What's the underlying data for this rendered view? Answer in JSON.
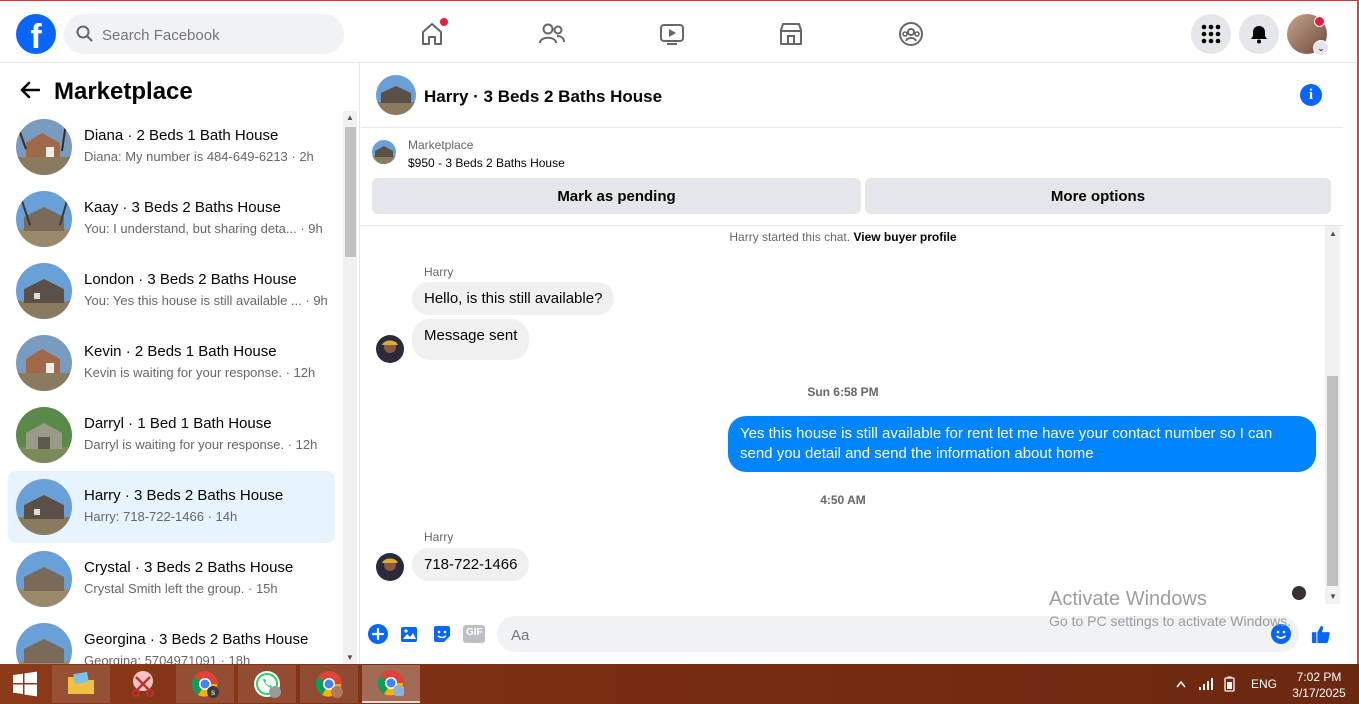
{
  "topbar": {
    "logo": "f",
    "search_placeholder": "Search Facebook"
  },
  "icons": {
    "nav": [
      "home-icon",
      "friends-icon",
      "watch-icon",
      "marketplace-icon",
      "groups-icon"
    ],
    "right": [
      "menu-grid-icon",
      "bell-icon",
      "profile-avatar"
    ]
  },
  "colors": {
    "brand": "#0866ff",
    "outgoing_bubble": "#0084ff",
    "notification_dot": "#e41e3f",
    "active_row": "#e7f3ff"
  },
  "sidebar": {
    "title": "Marketplace",
    "conversations": [
      {
        "title": "Diana · 2 Beds 1 Bath House",
        "preview": "Diana: My number is 484-649-6213 · 2h"
      },
      {
        "title": "Kaay · 3 Beds 2 Baths House",
        "preview": "You: I understand, but sharing deta... · 9h"
      },
      {
        "title": "London · 3 Beds 2 Baths House",
        "preview": "You: Yes this house is still available ... · 9h"
      },
      {
        "title": "Kevin · 2 Beds 1 Bath House",
        "preview": "Kevin is waiting for your response. · 12h"
      },
      {
        "title": "Darryl · 1 Bed 1 Bath House",
        "preview": "Darryl is waiting for your response. · 12h"
      },
      {
        "title": "Harry · 3 Beds 2 Baths House",
        "preview": "Harry: 718-722-1466 · 14h"
      },
      {
        "title": "Crystal · 3 Beds 2 Baths House",
        "preview": "Crystal Smith left the group. · 15h"
      },
      {
        "title": "Georgina · 3 Beds 2 Baths House",
        "preview": "Georgina: 5704971091 · 18h"
      }
    ]
  },
  "chat": {
    "title": "Harry · 3 Beds 2 Baths House",
    "listing": {
      "kind": "Marketplace",
      "price_title": "$950 - 3 Beds 2 Baths House",
      "mark_pending": "Mark as pending",
      "more_options": "More options"
    },
    "system_line": "Harry started this chat.",
    "system_link": "View buyer profile",
    "sender_name": "Harry",
    "msg1": "Hello, is this still available?",
    "msg2": "Message sent",
    "time1": "Sun 6:58 PM",
    "out_msg": "Yes this house is still available for rent let me have your contact number so I can send you detail and send the information about home",
    "time2": "4:50 AM",
    "msg3": "718-722-1466",
    "composer_placeholder": "Aa",
    "composer_icons": [
      "plus-icon",
      "photo-icon",
      "sticker-icon",
      "gif-icon",
      "emoji-icon",
      "like-icon"
    ],
    "gif_label": "GIF"
  },
  "watermark": {
    "line1": "Activate Windows",
    "line2": "Go to PC settings to activate Windows."
  },
  "taskbar": {
    "lang": "ENG",
    "time": "7:02 PM",
    "date": "3/17/2025"
  }
}
